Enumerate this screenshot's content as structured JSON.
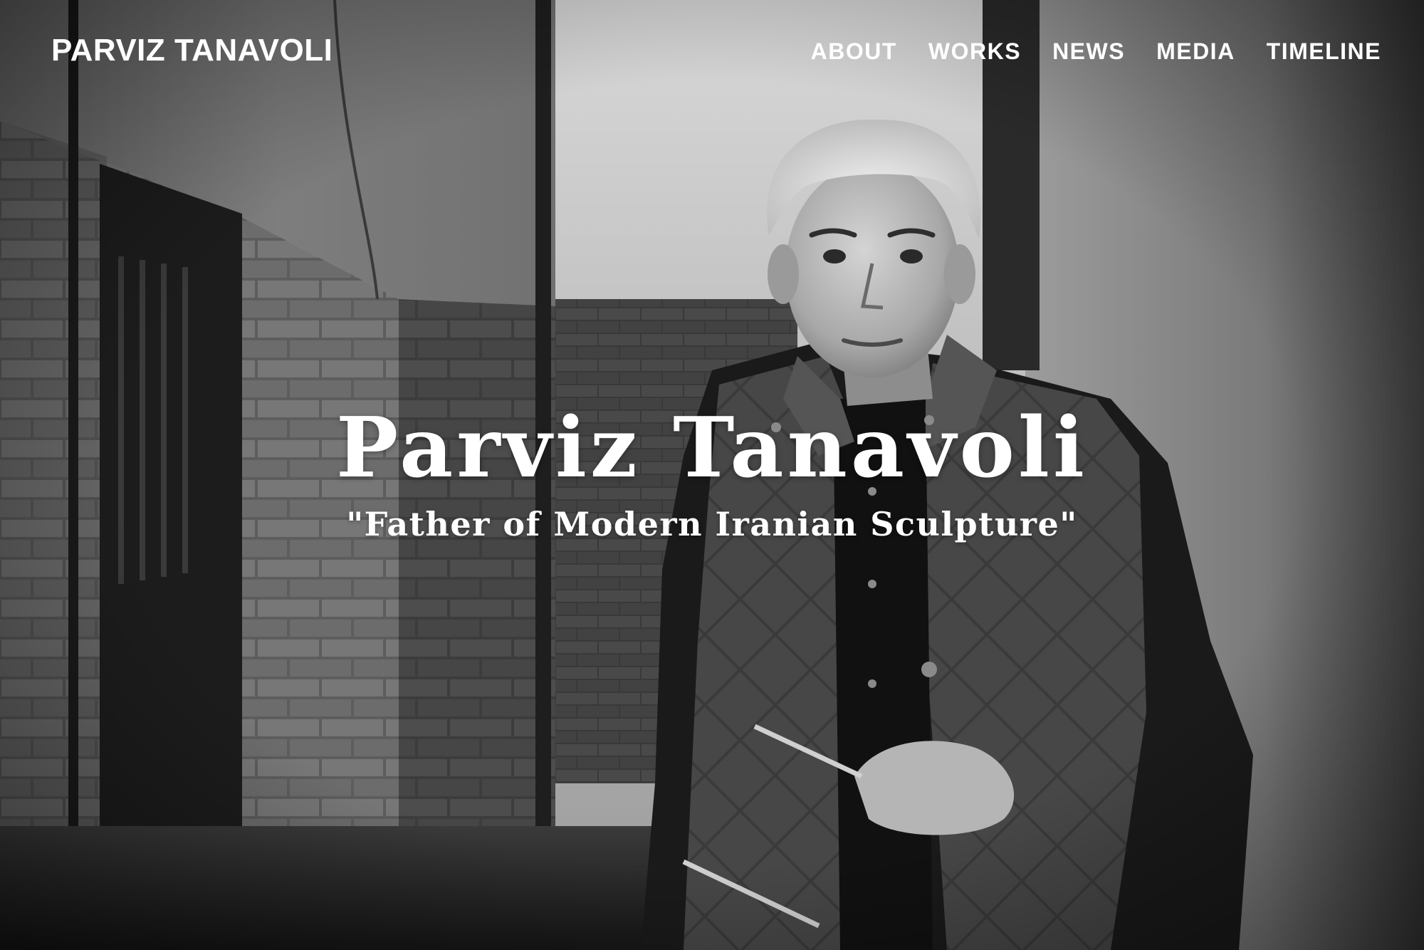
{
  "header": {
    "logo_text": "PARVIZ TANAVOLI",
    "nav": [
      {
        "label": "ABOUT"
      },
      {
        "label": "WORKS"
      },
      {
        "label": "NEWS"
      },
      {
        "label": "MEDIA"
      },
      {
        "label": "TIMELINE"
      }
    ]
  },
  "hero": {
    "title": "Parviz Tanavoli",
    "subtitle": "\"Father of Modern Iranian Sculpture\"",
    "image_tone": "black-and-white"
  },
  "colors": {
    "text": "#ffffff",
    "photo_dark": "#1a1a1a",
    "photo_mid": "#6b6b6b",
    "photo_light": "#cfcfcf"
  }
}
